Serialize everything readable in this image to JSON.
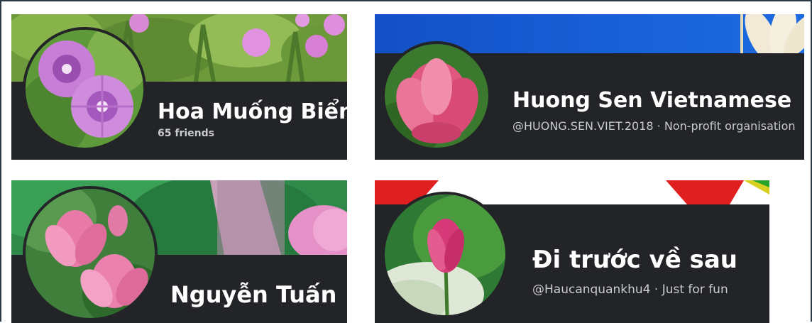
{
  "cards": [
    {
      "name": "Hoa Muống Biển",
      "subtitle": "65 friends",
      "cover_description_icon": "morning-glory-cover",
      "avatar_icon": "purple-morning-glory-icon"
    },
    {
      "name": "Huong Sen Vietnamese",
      "subtitle": "@HUONG.SEN.VIET.2018 · Non-profit organisation",
      "cover_description_icon": "blue-sky-flower-cover",
      "avatar_icon": "pink-lotus-icon"
    },
    {
      "name": "Nguyễn Tuấn",
      "subtitle": "",
      "cover_description_icon": "lotus-leaf-cover",
      "avatar_icon": "lotus-bunch-icon"
    },
    {
      "name": "Đi trước về sau",
      "subtitle": "@Haucanquankhu4 · Just for fun",
      "cover_description_icon": "red-banner-cover",
      "avatar_icon": "lotus-bud-icon"
    }
  ],
  "colors": {
    "card_bg": "#232427",
    "name_text": "#ffffff",
    "sub_text": "#c9cbcf",
    "frame_border": "#2b3a44"
  }
}
